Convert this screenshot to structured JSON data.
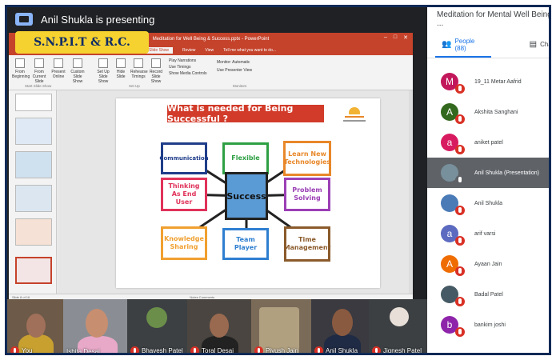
{
  "meeting": {
    "presenting_text": "Anil Shukla is presenting",
    "title": "Meditation for Mental Well Being ..."
  },
  "brand": {
    "label": "S.N.P.I.T & R.C."
  },
  "ppt": {
    "window_title": "Meditation for Well Being & Success.pptx - PowerPoint",
    "tabs": [
      "Slide Show",
      "Review",
      "View"
    ],
    "tell_me": "Tell me what you want to do...",
    "ribbon": [
      "From Beginning",
      "From Current Slide",
      "Present Online",
      "Custom Slide Show",
      "Set Up Slide Show",
      "Hide Slide",
      "Rehearse Timings",
      "Record Slide Show"
    ],
    "checks": [
      "Play Narrations",
      "Use Timings",
      "Show Media Controls"
    ],
    "monitor": "Monitor: Automatic",
    "presenter_view": "Use Presenter View",
    "groups": [
      "Start Slide Show",
      "Set Up",
      "Monitors"
    ],
    "status_left": "Slide 8 of 16",
    "status_right": "Notes   Comments"
  },
  "slide": {
    "title": "What is needed for Being Successful ?",
    "center": "Success",
    "boxes": [
      {
        "label": "Communication",
        "color": "#1f3d8a"
      },
      {
        "label": "Flexible",
        "color": "#2ea043"
      },
      {
        "label": "Learn New Technologies",
        "color": "#e8882a"
      },
      {
        "label": "Thinking As End User",
        "color": "#e0335a"
      },
      {
        "label": "Problem Solving",
        "color": "#9b3fb5"
      },
      {
        "label": "Knowledge Sharing",
        "color": "#f0a030"
      },
      {
        "label": "Team Player",
        "color": "#2f7fd0"
      },
      {
        "label": "Time Management",
        "color": "#8a5a2b"
      }
    ]
  },
  "videos": [
    {
      "name": "You"
    },
    {
      "name": "Ishita Desai"
    },
    {
      "name": "Bhavesh Patel"
    },
    {
      "name": "Toral Desai"
    },
    {
      "name": "Piyush Jain"
    },
    {
      "name": "Anil Shukla"
    },
    {
      "name": "Jignesh Patel"
    }
  ],
  "panel": {
    "people_tab": "People (88)",
    "chat_tab": "Chat",
    "people": [
      {
        "initial": "M",
        "name": "19_11 Metar Aafrid",
        "color": "#c2185b"
      },
      {
        "initial": "A",
        "name": "Akshita Sanghani",
        "color": "#33691e"
      },
      {
        "initial": "a",
        "name": "aniket patel",
        "color": "#d81b60"
      },
      {
        "initial": "",
        "name": "Anil Shukla (Presentation)",
        "color": "#78909c"
      },
      {
        "initial": "",
        "name": "Anil Shukla",
        "color": "#4a7bb7"
      },
      {
        "initial": "a",
        "name": "arif varsi",
        "color": "#5c6bc0"
      },
      {
        "initial": "A",
        "name": "Ayaan Jain",
        "color": "#ef6c00"
      },
      {
        "initial": "",
        "name": "Badal Patel",
        "color": "#455a64"
      },
      {
        "initial": "b",
        "name": "bankim joshi",
        "color": "#8e24aa"
      }
    ]
  }
}
